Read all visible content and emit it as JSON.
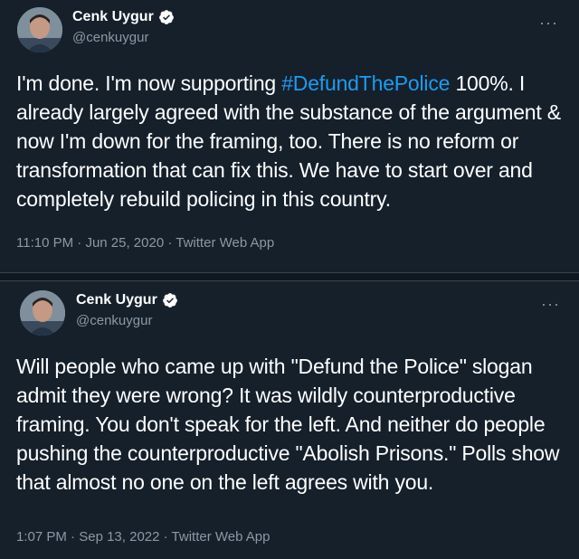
{
  "tweets": [
    {
      "author": {
        "name": "Cenk Uygur",
        "handle": "@cenkuygur",
        "verified": true
      },
      "text_before": "I'm done. I'm now supporting ",
      "hashtag": "#DefundThePolice",
      "text_after": " 100%. I already largely agreed with the substance of the argument & now I'm down for the framing, too. There is no reform or transformation that can fix this. We have to start over and completely rebuild policing in this country.",
      "time": "11:10 PM",
      "date": "Jun 25, 2020",
      "source": "Twitter Web App",
      "separator": "·"
    },
    {
      "author": {
        "name": "Cenk Uygur",
        "handle": "@cenkuygur",
        "verified": true
      },
      "text": "Will people who came up with \"Defund the Police\" slogan admit they were wrong? It was wildly counterproductive framing. You don't speak for the left. And neither do people pushing the counterproductive \"Abolish Prisons.\" Polls show that almost no one on the left agrees with you.",
      "time": "1:07 PM",
      "date": "Sep 13, 2022",
      "source": "Twitter Web App",
      "separator": "·"
    }
  ],
  "icons": {
    "verified": "verified-badge-icon",
    "more": "more-options-icon"
  },
  "colors": {
    "background": "#15202b",
    "text": "#ffffff",
    "muted": "#8b98a5",
    "link": "#1d9bf0",
    "verified": "#ffffff"
  }
}
